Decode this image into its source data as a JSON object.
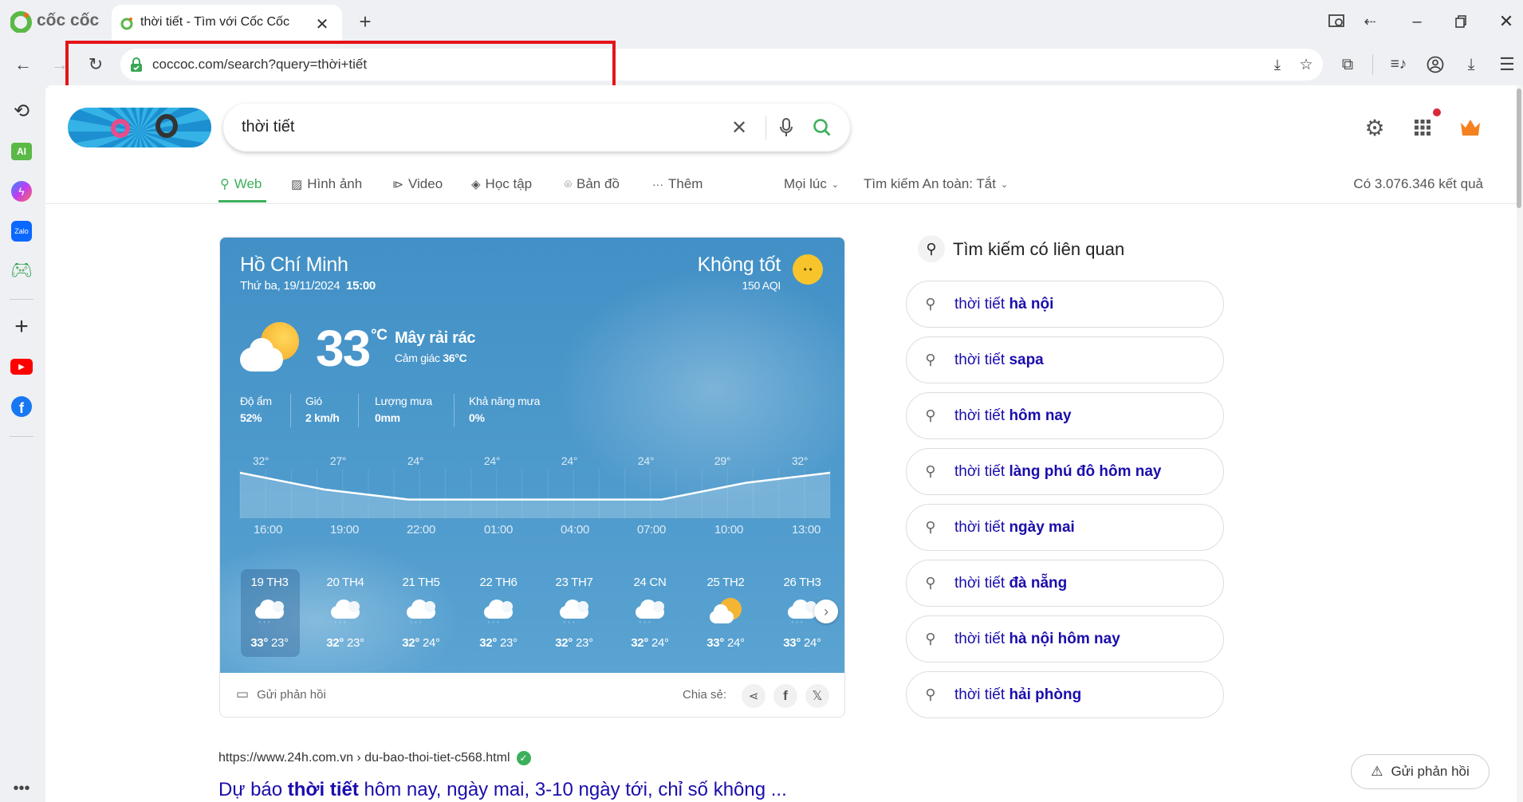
{
  "browser": {
    "brand": "cốc cốc",
    "tab_title": "thời tiết - Tìm với Cốc Cốc",
    "url": "coccoc.com/search?query=thời+tiết",
    "highlight_color": "#e3151a"
  },
  "search": {
    "query": "thời tiết",
    "tabs": [
      "Web",
      "Hình ảnh",
      "Video",
      "Học tập",
      "Bản đồ",
      "Thêm"
    ],
    "filter_time": "Mọi lúc",
    "filter_safe": "Tìm kiếm An toàn: Tắt",
    "result_count": "Có 3.076.346 kết quả",
    "accent": "#3db05b"
  },
  "weather": {
    "city": "Hồ Chí Minh",
    "date": "Thứ ba, 19/11/2024",
    "time": "15:00",
    "aqi_status": "Không tốt",
    "aqi": "150 AQI",
    "temp": "33",
    "unit": "°C",
    "condition": "Mây rải rác",
    "feels_label": "Cảm giác",
    "feels": "36°C",
    "stats": [
      {
        "label": "Độ ẩm",
        "value": "52%"
      },
      {
        "label": "Gió",
        "value": "2 km/h"
      },
      {
        "label": "Lượng mưa",
        "value": "0mm"
      },
      {
        "label": "Khả năng mưa",
        "value": "0%"
      }
    ],
    "hourly": [
      {
        "time": "16:00",
        "temp": 32,
        "label": "32°"
      },
      {
        "time": "19:00",
        "temp": 27,
        "label": "27°"
      },
      {
        "time": "22:00",
        "temp": 24,
        "label": "24°"
      },
      {
        "time": "01:00",
        "temp": 24,
        "label": "24°"
      },
      {
        "time": "04:00",
        "temp": 24,
        "label": "24°"
      },
      {
        "time": "07:00",
        "temp": 24,
        "label": "24°"
      },
      {
        "time": "10:00",
        "temp": 29,
        "label": "29°"
      },
      {
        "time": "13:00",
        "temp": 32,
        "label": "32°"
      }
    ],
    "daily": [
      {
        "day": "19 TH3",
        "hi": "33°",
        "lo": "23°",
        "icon": "rain-cloud-icon"
      },
      {
        "day": "20 TH4",
        "hi": "32°",
        "lo": "23°",
        "icon": "drizzle-icon"
      },
      {
        "day": "21 TH5",
        "hi": "32°",
        "lo": "24°",
        "icon": "rain-cloud-icon"
      },
      {
        "day": "22 TH6",
        "hi": "32°",
        "lo": "23°",
        "icon": "rain-cloud-icon"
      },
      {
        "day": "23 TH7",
        "hi": "32°",
        "lo": "23°",
        "icon": "rain-cloud-icon"
      },
      {
        "day": "24 CN",
        "hi": "32°",
        "lo": "24°",
        "icon": "rain-cloud-icon"
      },
      {
        "day": "25 TH2",
        "hi": "33°",
        "lo": "24°",
        "icon": "partly-cloudy-icon"
      },
      {
        "day": "26 TH3",
        "hi": "33°",
        "lo": "24°",
        "icon": "rain-cloud-icon"
      }
    ],
    "feedback": "Gửi phản hồi",
    "share_label": "Chia sẻ:"
  },
  "related": {
    "title": "Tìm kiếm có liên quan",
    "items": [
      {
        "prefix": "thời tiết",
        "bold": "hà nội"
      },
      {
        "prefix": "thời tiết",
        "bold": "sapa"
      },
      {
        "prefix": "thời tiết",
        "bold": "hôm nay"
      },
      {
        "prefix": "thời tiết",
        "bold": "làng phú đô hôm nay"
      },
      {
        "prefix": "thời tiết",
        "bold": "ngày mai"
      },
      {
        "prefix": "thời tiết",
        "bold": "đà nẵng"
      },
      {
        "prefix": "thời tiết",
        "bold": "hà nội hôm nay"
      },
      {
        "prefix": "thời tiết",
        "bold": "hải phòng"
      }
    ]
  },
  "result": {
    "url": "https://www.24h.com.vn › du-bao-thoi-tiet-c568.html",
    "title_pre": "Dự báo ",
    "title_bold": "thời tiết",
    "title_post": " hôm nay, ngày mai, 3-10 ngày tới, chỉ số không ..."
  },
  "feedback_button": "Gửi phản hồi"
}
